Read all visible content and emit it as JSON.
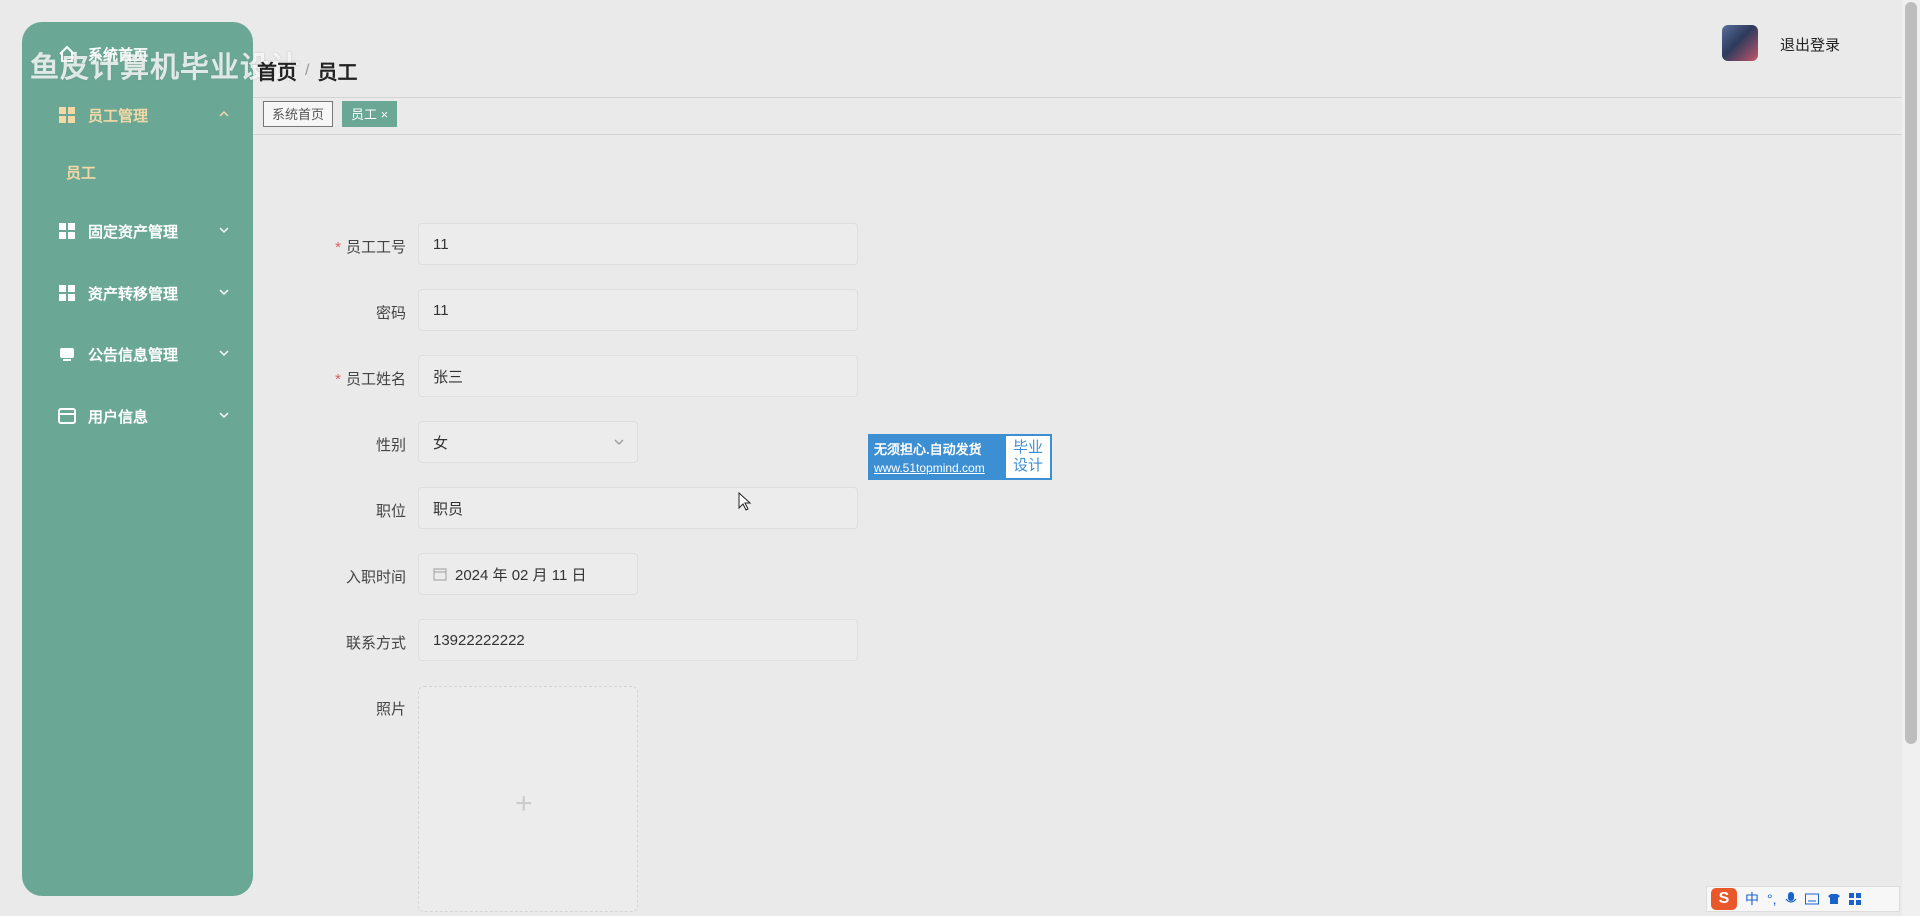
{
  "watermark": "鱼皮计算机毕业设计",
  "sidebar": {
    "home_label": "系统首页",
    "items": [
      {
        "label": "员工管理",
        "expanded": true,
        "children": [
          "员工"
        ]
      },
      {
        "label": "固定资产管理"
      },
      {
        "label": "资产转移管理"
      },
      {
        "label": "公告信息管理"
      },
      {
        "label": "用户信息"
      }
    ]
  },
  "header": {
    "breadcrumb": [
      "首页",
      "员工"
    ],
    "logout_label": "退出登录"
  },
  "tabs": [
    {
      "label": "系统首页",
      "active": false
    },
    {
      "label": "员工",
      "active": true,
      "close": "×"
    }
  ],
  "form": {
    "employee_no": {
      "label": "员工工号",
      "value": "11",
      "required": true
    },
    "password": {
      "label": "密码",
      "value": "11"
    },
    "name": {
      "label": "员工姓名",
      "value": "张三",
      "required": true
    },
    "gender": {
      "label": "性别",
      "value": "女"
    },
    "position": {
      "label": "职位",
      "value": "职员"
    },
    "hire_date": {
      "label": "入职时间",
      "value": "2024 年 02 月 11 日"
    },
    "contact": {
      "label": "联系方式",
      "value": "13922222222"
    },
    "photo": {
      "label": "照片",
      "upload_symbol": "+"
    }
  },
  "ad": {
    "line1": "无须担心.自动发货",
    "line2": "www.51topmind.com",
    "badge": "毕业设计"
  },
  "ime": {
    "mode": "中",
    "punct": "°,"
  },
  "colors": {
    "sidebar": "#6aa895",
    "active_text": "#f3d9a6",
    "required": "#e05d5d",
    "ad_blue": "#3d8fd3"
  }
}
